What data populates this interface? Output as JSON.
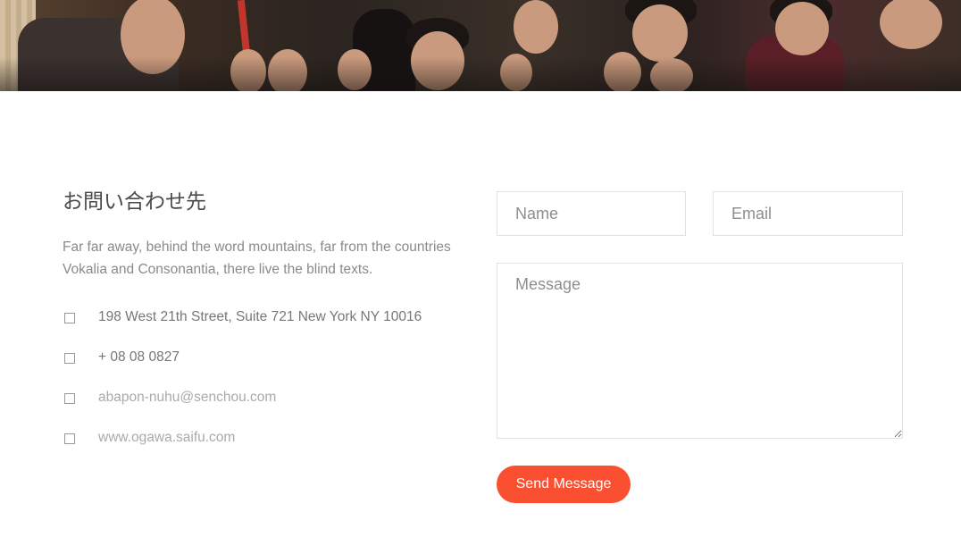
{
  "hero": {
    "image_alt": "group photo"
  },
  "contact": {
    "title": "お問い合わせ先",
    "description": "Far far away, behind the word mountains, far from the countries Vokalia and Consonantia, there live the blind texts.",
    "items": [
      {
        "icon": "checkbox-icon",
        "text": "198 West 21th Street, Suite 721 New York NY 10016"
      },
      {
        "icon": "checkbox-icon",
        "text": "+ 08 08 0827"
      },
      {
        "icon": "checkbox-icon",
        "text": "abapon-nuhu@senchou.com"
      },
      {
        "icon": "checkbox-icon",
        "text": "www.ogawa.saifu.com"
      }
    ]
  },
  "form": {
    "name_placeholder": "Name",
    "email_placeholder": "Email",
    "message_placeholder": "Message",
    "send_label": "Send Message"
  },
  "colors": {
    "accent": "#fb4f32",
    "text": "#8a8a8a",
    "title": "#4a4a4a",
    "border": "#e1e1e1"
  }
}
